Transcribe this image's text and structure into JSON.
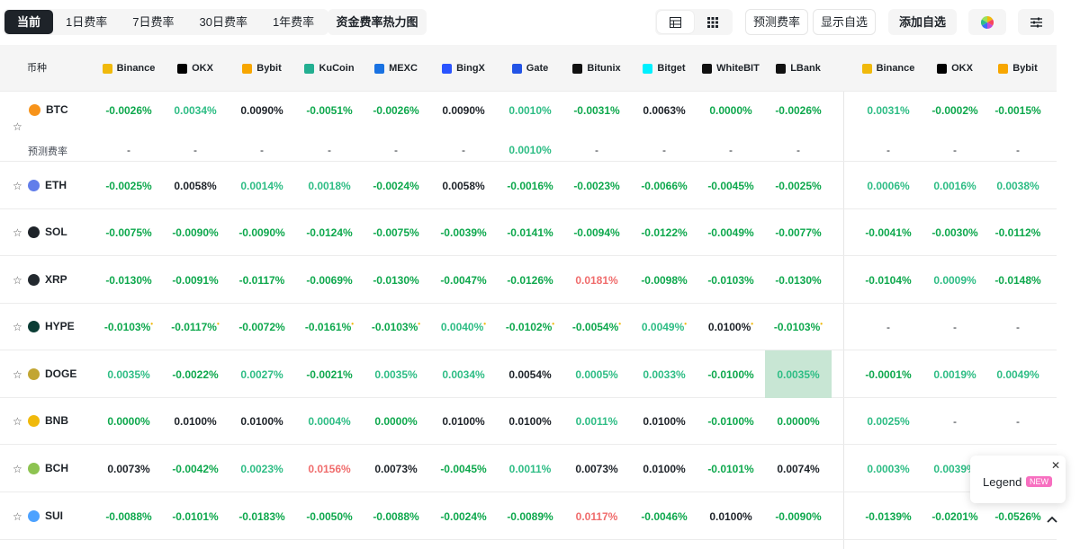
{
  "toolbar": {
    "tabs": [
      {
        "label": "当前",
        "active": true
      },
      {
        "label": "1日费率",
        "active": false
      },
      {
        "label": "7日费率",
        "active": false
      },
      {
        "label": "30日费率",
        "active": false
      },
      {
        "label": "1年费率",
        "active": false
      }
    ],
    "heatmap_label": "资金费率热力图",
    "view_modes": [
      "table-icon",
      "grid-icon"
    ],
    "predict_label": "预测费率",
    "show_watchlist_label": "显示自选",
    "add_watchlist_label": "添加自选",
    "theme_icon": "color-wheel-icon",
    "settings_icon": "sliders-icon"
  },
  "table": {
    "symbol_header": "币种",
    "exchanges": [
      {
        "name": "Binance",
        "color": "#f0b90b"
      },
      {
        "name": "OKX",
        "color": "#000000"
      },
      {
        "name": "Bybit",
        "color": "#f7a600"
      },
      {
        "name": "KuCoin",
        "color": "#23af91"
      },
      {
        "name": "MEXC",
        "color": "#1972e2"
      },
      {
        "name": "BingX",
        "color": "#2a54ff"
      },
      {
        "name": "Gate",
        "color": "#2354e6"
      },
      {
        "name": "Bitunix",
        "color": "#111111"
      },
      {
        "name": "Bitget",
        "color": "#00f0ff"
      },
      {
        "name": "WhiteBIT",
        "color": "#111111"
      },
      {
        "name": "LBank",
        "color": "#111111"
      },
      {
        "name": "Binance",
        "color": "#f0b90b"
      },
      {
        "name": "OKX",
        "color": "#000000"
      },
      {
        "name": "Bybit",
        "color": "#f7a600"
      }
    ],
    "predicted_label": "预测费率",
    "rows": [
      {
        "symbol": "BTC",
        "coin_color": "#f7931a",
        "values": [
          {
            "v": "-0.0026%",
            "c": "gd"
          },
          {
            "v": "0.0034%",
            "c": "gl"
          },
          {
            "v": "0.0090%",
            "c": "bk"
          },
          {
            "v": "-0.0051%",
            "c": "gd"
          },
          {
            "v": "-0.0026%",
            "c": "gd"
          },
          {
            "v": "0.0090%",
            "c": "bk"
          },
          {
            "v": "0.0010%",
            "c": "gl"
          },
          {
            "v": "-0.0031%",
            "c": "gd"
          },
          {
            "v": "0.0063%",
            "c": "bk"
          },
          {
            "v": "0.0000%",
            "c": "gd"
          },
          {
            "v": "-0.0026%",
            "c": "gd"
          },
          {
            "v": "0.0031%",
            "c": "gl"
          },
          {
            "v": "-0.0002%",
            "c": "gd"
          },
          {
            "v": "-0.0015%",
            "c": "gd"
          }
        ],
        "predicted": [
          "-",
          "-",
          "-",
          "-",
          "-",
          "-",
          "0.0010%",
          "-",
          "-",
          "-",
          "-",
          "-",
          "-",
          "-"
        ]
      },
      {
        "symbol": "ETH",
        "coin_color": "#627eea",
        "values": [
          {
            "v": "-0.0025%",
            "c": "gd"
          },
          {
            "v": "0.0058%",
            "c": "bk"
          },
          {
            "v": "0.0014%",
            "c": "gl"
          },
          {
            "v": "0.0018%",
            "c": "gl"
          },
          {
            "v": "-0.0024%",
            "c": "gd"
          },
          {
            "v": "0.0058%",
            "c": "bk"
          },
          {
            "v": "-0.0016%",
            "c": "gd"
          },
          {
            "v": "-0.0023%",
            "c": "gd"
          },
          {
            "v": "-0.0066%",
            "c": "gd"
          },
          {
            "v": "-0.0045%",
            "c": "gd"
          },
          {
            "v": "-0.0025%",
            "c": "gd"
          },
          {
            "v": "0.0006%",
            "c": "gl"
          },
          {
            "v": "0.0016%",
            "c": "gl"
          },
          {
            "v": "0.0038%",
            "c": "gl"
          }
        ]
      },
      {
        "symbol": "SOL",
        "coin_color": "#1e2329",
        "values": [
          {
            "v": "-0.0075%",
            "c": "gd"
          },
          {
            "v": "-0.0090%",
            "c": "gd"
          },
          {
            "v": "-0.0090%",
            "c": "gd"
          },
          {
            "v": "-0.0124%",
            "c": "gd"
          },
          {
            "v": "-0.0075%",
            "c": "gd"
          },
          {
            "v": "-0.0039%",
            "c": "gd"
          },
          {
            "v": "-0.0141%",
            "c": "gd"
          },
          {
            "v": "-0.0094%",
            "c": "gd"
          },
          {
            "v": "-0.0122%",
            "c": "gd"
          },
          {
            "v": "-0.0049%",
            "c": "gd"
          },
          {
            "v": "-0.0077%",
            "c": "gd"
          },
          {
            "v": "-0.0041%",
            "c": "gd"
          },
          {
            "v": "-0.0030%",
            "c": "gd"
          },
          {
            "v": "-0.0112%",
            "c": "gd"
          }
        ]
      },
      {
        "symbol": "XRP",
        "coin_color": "#23292f",
        "values": [
          {
            "v": "-0.0130%",
            "c": "gd"
          },
          {
            "v": "-0.0091%",
            "c": "gd"
          },
          {
            "v": "-0.0117%",
            "c": "gd"
          },
          {
            "v": "-0.0069%",
            "c": "gd"
          },
          {
            "v": "-0.0130%",
            "c": "gd"
          },
          {
            "v": "-0.0047%",
            "c": "gd"
          },
          {
            "v": "-0.0126%",
            "c": "gd"
          },
          {
            "v": "0.0181%",
            "c": "rd"
          },
          {
            "v": "-0.0098%",
            "c": "gd"
          },
          {
            "v": "-0.0103%",
            "c": "gd"
          },
          {
            "v": "-0.0130%",
            "c": "gd"
          },
          {
            "v": "-0.0104%",
            "c": "gd"
          },
          {
            "v": "0.0009%",
            "c": "gl"
          },
          {
            "v": "-0.0148%",
            "c": "gd"
          }
        ]
      },
      {
        "symbol": "HYPE",
        "coin_color": "#0b3d35",
        "marked": [
          0,
          1,
          3,
          4,
          5,
          6,
          7,
          8,
          9,
          10
        ],
        "values": [
          {
            "v": "-0.0103%",
            "c": "gd"
          },
          {
            "v": "-0.0117%",
            "c": "gd"
          },
          {
            "v": "-0.0072%",
            "c": "gd"
          },
          {
            "v": "-0.0161%",
            "c": "gd"
          },
          {
            "v": "-0.0103%",
            "c": "gd"
          },
          {
            "v": "0.0040%",
            "c": "gl"
          },
          {
            "v": "-0.0102%",
            "c": "gd"
          },
          {
            "v": "-0.0054%",
            "c": "gd"
          },
          {
            "v": "0.0049%",
            "c": "gl"
          },
          {
            "v": "0.0100%",
            "c": "bk"
          },
          {
            "v": "-0.0103%",
            "c": "gd"
          },
          {
            "v": "-",
            "c": "ds"
          },
          {
            "v": "-",
            "c": "ds"
          },
          {
            "v": "-",
            "c": "ds"
          }
        ]
      },
      {
        "symbol": "DOGE",
        "coin_color": "#c2a633",
        "highlight_col": 10,
        "values": [
          {
            "v": "0.0035%",
            "c": "gl"
          },
          {
            "v": "-0.0022%",
            "c": "gd"
          },
          {
            "v": "0.0027%",
            "c": "gl"
          },
          {
            "v": "-0.0021%",
            "c": "gd"
          },
          {
            "v": "0.0035%",
            "c": "gl"
          },
          {
            "v": "0.0034%",
            "c": "gl"
          },
          {
            "v": "0.0054%",
            "c": "bk"
          },
          {
            "v": "0.0005%",
            "c": "gl"
          },
          {
            "v": "0.0033%",
            "c": "gl"
          },
          {
            "v": "-0.0100%",
            "c": "gd"
          },
          {
            "v": "0.0035%",
            "c": "gl"
          },
          {
            "v": "-0.0001%",
            "c": "gd"
          },
          {
            "v": "0.0019%",
            "c": "gl"
          },
          {
            "v": "0.0049%",
            "c": "gl"
          }
        ]
      },
      {
        "symbol": "BNB",
        "coin_color": "#f0b90b",
        "values": [
          {
            "v": "0.0000%",
            "c": "gd"
          },
          {
            "v": "0.0100%",
            "c": "bk"
          },
          {
            "v": "0.0100%",
            "c": "bk"
          },
          {
            "v": "0.0004%",
            "c": "gl"
          },
          {
            "v": "0.0000%",
            "c": "gd"
          },
          {
            "v": "0.0100%",
            "c": "bk"
          },
          {
            "v": "0.0100%",
            "c": "bk"
          },
          {
            "v": "0.0011%",
            "c": "gl"
          },
          {
            "v": "0.0100%",
            "c": "bk"
          },
          {
            "v": "-0.0100%",
            "c": "gd"
          },
          {
            "v": "0.0000%",
            "c": "gd"
          },
          {
            "v": "0.0025%",
            "c": "gl"
          },
          {
            "v": "-",
            "c": "ds"
          },
          {
            "v": "-",
            "c": "ds"
          }
        ]
      },
      {
        "symbol": "BCH",
        "coin_color": "#8dc351",
        "values": [
          {
            "v": "0.0073%",
            "c": "bk"
          },
          {
            "v": "-0.0042%",
            "c": "gd"
          },
          {
            "v": "0.0023%",
            "c": "gl"
          },
          {
            "v": "0.0156%",
            "c": "rd"
          },
          {
            "v": "0.0073%",
            "c": "bk"
          },
          {
            "v": "-0.0045%",
            "c": "gd"
          },
          {
            "v": "0.0011%",
            "c": "gl"
          },
          {
            "v": "0.0073%",
            "c": "bk"
          },
          {
            "v": "0.0100%",
            "c": "bk"
          },
          {
            "v": "-0.0101%",
            "c": "gd"
          },
          {
            "v": "0.0074%",
            "c": "bk"
          },
          {
            "v": "0.0003%",
            "c": "gl"
          },
          {
            "v": "0.0039%",
            "c": "gl"
          },
          {
            "v": "",
            "c": "ds"
          }
        ]
      },
      {
        "symbol": "SUI",
        "coin_color": "#4da2ff",
        "values": [
          {
            "v": "-0.0088%",
            "c": "gd"
          },
          {
            "v": "-0.0101%",
            "c": "gd"
          },
          {
            "v": "-0.0183%",
            "c": "gd"
          },
          {
            "v": "-0.0050%",
            "c": "gd"
          },
          {
            "v": "-0.0088%",
            "c": "gd"
          },
          {
            "v": "-0.0024%",
            "c": "gd"
          },
          {
            "v": "-0.0089%",
            "c": "gd"
          },
          {
            "v": "0.0117%",
            "c": "rd"
          },
          {
            "v": "-0.0046%",
            "c": "gd"
          },
          {
            "v": "0.0100%",
            "c": "bk"
          },
          {
            "v": "-0.0090%",
            "c": "gd"
          },
          {
            "v": "-0.0139%",
            "c": "gd"
          },
          {
            "v": "-0.0201%",
            "c": "gd"
          },
          {
            "v": "-0.0526%",
            "c": "gd"
          }
        ]
      }
    ]
  },
  "legend": {
    "label": "Legend",
    "badge": "NEW",
    "close_icon": "close-icon"
  },
  "scroll_top_icon": "chevron-up-icon"
}
